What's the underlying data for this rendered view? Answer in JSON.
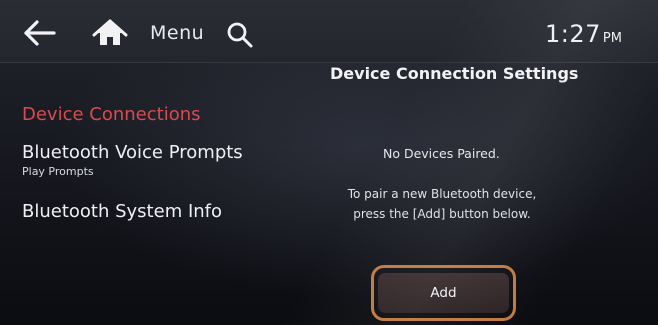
{
  "header": {
    "menu_label": "Menu",
    "time": "1:27",
    "ampm": "PM"
  },
  "icons": {
    "back": "back-arrow-icon",
    "home": "home-icon",
    "search": "search-icon"
  },
  "page": {
    "title": "Device Connection Settings"
  },
  "sidebar": {
    "items": [
      {
        "label": "Device Connections",
        "active": true
      },
      {
        "label": "Bluetooth Voice Prompts",
        "sublabel": "Play Prompts"
      },
      {
        "label": "Bluetooth System Info"
      }
    ]
  },
  "main": {
    "status": "No Devices Paired.",
    "instruction_line1": "To pair a new Bluetooth device,",
    "instruction_line2": "press the [Add] button below.",
    "add_label": "Add"
  },
  "colors": {
    "active_item": "#d94b4f",
    "highlight_outline": "#c07a3e",
    "text": "#eef0f4"
  }
}
